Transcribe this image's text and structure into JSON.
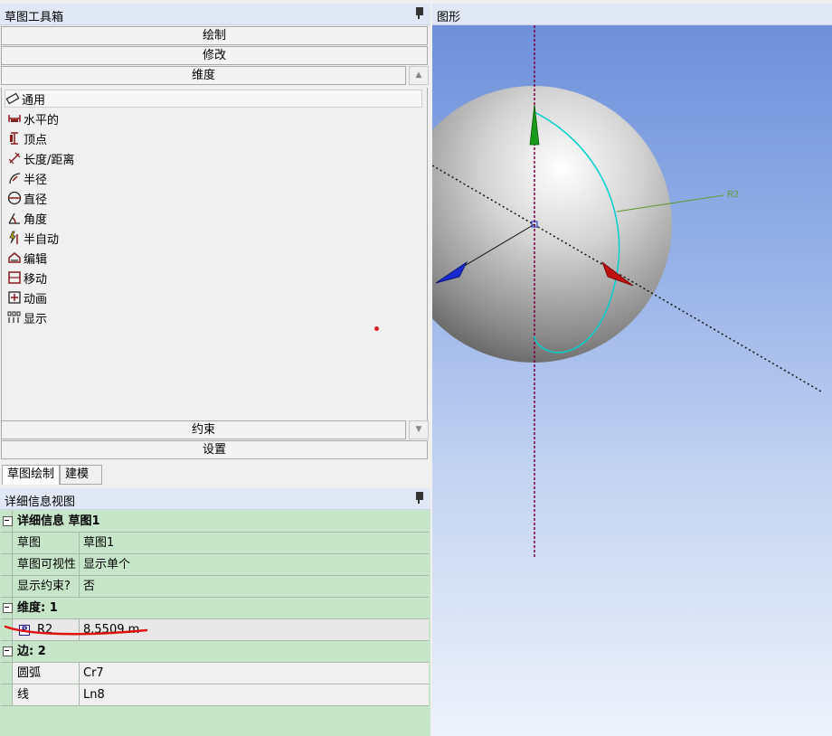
{
  "toolbox": {
    "title": "草图工具箱",
    "sections": {
      "draw": "绘制",
      "modify": "修改",
      "dimensions": "维度",
      "constraints": "约束",
      "settings": "设置"
    },
    "tools": [
      {
        "label": "通用",
        "icon": "ruler-icon"
      },
      {
        "label": "水平的",
        "icon": "horizontal-dim-icon"
      },
      {
        "label": "顶点",
        "icon": "vertical-dim-icon"
      },
      {
        "label": "长度/距离",
        "icon": "length-dim-icon"
      },
      {
        "label": "半径",
        "icon": "radius-dim-icon"
      },
      {
        "label": "直径",
        "icon": "diameter-dim-icon"
      },
      {
        "label": "角度",
        "icon": "angle-dim-icon"
      },
      {
        "label": "半自动",
        "icon": "semi-auto-icon"
      },
      {
        "label": "编辑",
        "icon": "edit-dim-icon"
      },
      {
        "label": "移动",
        "icon": "move-dim-icon"
      },
      {
        "label": "动画",
        "icon": "animate-icon"
      },
      {
        "label": "显示",
        "icon": "display-icon"
      }
    ],
    "tabs": {
      "sketching": "草图绘制",
      "modeling": "建模"
    }
  },
  "details": {
    "title": "详细信息视图",
    "group1": "详细信息 草图1",
    "sketch_key": "草图",
    "sketch_val": "草图1",
    "visibility_key": "草图可视性",
    "visibility_val": "显示单个",
    "show_constraints_key": "显示约束?",
    "show_constraints_val": "否",
    "group2": "维度: 1",
    "dim_badge": "P",
    "dim_key": "R2",
    "dim_val": "8.5509 m",
    "group3": "边: 2",
    "arc_key": "圆弧",
    "arc_val": "Cr7",
    "line_key": "线",
    "line_val": "Ln8"
  },
  "graphics": {
    "title": "图形",
    "dimension_label": "R2",
    "colors": {
      "sphere": "#bdbdbd",
      "arc": "#00d0d0",
      "dim_line": "#5a9a2a",
      "axis_green": "#1a9a1a",
      "axis_red": "#c01010",
      "axis_blue": "#1a2ad0",
      "annotation": "#e01010"
    }
  }
}
